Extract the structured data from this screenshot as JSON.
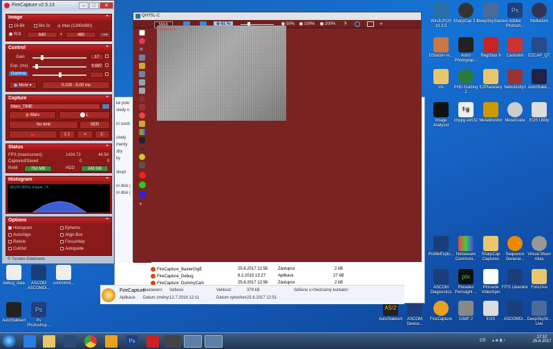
{
  "firecapture": {
    "title": "FireCapture v2.5.13",
    "image": {
      "header": "Image",
      "bit16": "16 Bit",
      "bin2x": "Bin 2x",
      "max": "Max (1280x960)",
      "roi": "ROI",
      "width": "640",
      "x": "x",
      "height": "480"
    },
    "control": {
      "header": "Control",
      "gain_label": "Gain",
      "gain_value": "17",
      "exp_label": "Exp. (ms)",
      "exp_value": "0.697",
      "gamma_label": "Gamma",
      "more": "More",
      "range": "0.100 - 5.00 ms"
    },
    "capture": {
      "header": "Capture",
      "profile": "Mars_TIME",
      "btn_mars": "Mars",
      "btn_l": "L",
      "nolimit": "No limit",
      "ser": "SER"
    },
    "status": {
      "header": "Status",
      "fps_label": "FPS (max/current)",
      "fps_max": "1434.72",
      "fps_cur": "44.54",
      "captured_label": "Captured/Saved",
      "captured": "0",
      "saved": "0",
      "ram_label": "RAM",
      "ram": "792 MB",
      "hdd_label": "HDD",
      "hdd": "243 GB"
    },
    "histogram": {
      "header": "Histogram",
      "stats": "64(220 (86%)  Unique: 74"
    },
    "options": {
      "header": "Options",
      "left": [
        "Histogram",
        "AutoAlign",
        "Reticle",
        "CutOut"
      ],
      "right": [
        "Ephems",
        "Align-Box",
        "FocusHelp",
        "Autoguide"
      ],
      "footer": "© Torsten Edelmann"
    }
  },
  "qhy": {
    "title": "QHY5L-C",
    "zoom": "61 %",
    "max": "MAX",
    "z50": "50%",
    "z100": "100%",
    "z200": "200%",
    "overlay": "Zoom 61%"
  },
  "explorer": {
    "nav": [
      "ké polo",
      "sledy n",
      "",
      "ní soub",
      "",
      "ulody",
      "menty",
      "zby",
      "ky",
      "",
      "skupi",
      "",
      "ní disk (",
      "ní disk ("
    ],
    "files": [
      {
        "name": "FireCapture_BaslerGigE",
        "date": "25.6.2017 12:56",
        "type": "Zástupce",
        "size": "2 kB"
      },
      {
        "name": "FireCapture_Debug",
        "date": "6.2.2015 13:27",
        "type": "Aplikace",
        "size": "27 kB"
      },
      {
        "name": "FireCapture_DummyCam",
        "date": "25.6.2017 12:56",
        "type": "Zástupce",
        "size": "2 kB"
      }
    ],
    "details": {
      "name": "FireCapture",
      "kind": "Aplikace",
      "settings_label": "Nastavení:",
      "settings": "Sdíleno",
      "size_label": "Velikost:",
      "size": "379 kB",
      "shared_label": "Sdíleno s:",
      "shared": "<Neznámý kontakt>",
      "modified_label": "Datum změny:",
      "modified": "12.7.2016 12:11",
      "created_label": "Datum vytvoření:",
      "created": "25.6.2017 12:51"
    }
  },
  "desktop_icons": [
    {
      "label": "WinJUPOS 10.3.5",
      "color": "#2a6fa6"
    },
    {
      "label": "SharpCap 2.9",
      "color": "#333"
    },
    {
      "label": "DeepSkyStacker",
      "color": "#4a6a9a"
    },
    {
      "label": "Adobe Photosh...",
      "color": "#1f3f7f"
    },
    {
      "label": "Stellarium",
      "color": "#335"
    },
    {
      "label": "DStation-m...",
      "color": "#c74"
    },
    {
      "label": "Astro Photograp...",
      "color": "#222"
    },
    {
      "label": "RegiStax 6",
      "color": "#c22"
    },
    {
      "label": "Castrator",
      "color": "#c33"
    },
    {
      "label": "EZCAP_QT",
      "color": "#2a4a8a"
    },
    {
      "label": "iris",
      "color": "#e9c66b"
    },
    {
      "label": "PHD Guiding 2",
      "color": "#2a7a3a"
    },
    {
      "label": "EZPlanetary",
      "color": "#e9c66b"
    },
    {
      "label": "Nebulosity3",
      "color": "#933"
    },
    {
      "label": "AutoStakk...",
      "color": "#224"
    },
    {
      "label": "Image Analyzer",
      "color": "#111"
    },
    {
      "label": "imppg-win32",
      "color": "#eee"
    },
    {
      "label": "MetaMonitor",
      "color": "#c90"
    },
    {
      "label": "MetaGuide",
      "color": "#ccc"
    },
    {
      "label": "EOS Utility",
      "color": "#ddd"
    },
    {
      "label": "ProfileExplo...",
      "color": "#1b3d7a"
    },
    {
      "label": "Noiseware Communi...",
      "color": "#e44"
    },
    {
      "label": "SharpCap Captures",
      "color": "#e9c66b"
    },
    {
      "label": "Sequence Generat...",
      "color": "#e80"
    },
    {
      "label": "Virtual Moon Atlas",
      "color": "#999"
    },
    {
      "label": "ASCOM Diagnostics",
      "color": "#1b3d7a"
    },
    {
      "label": "Pleiades Pixinsight ...",
      "color": "#111"
    },
    {
      "label": "Pinnacle VideoSpin",
      "color": "#fff"
    },
    {
      "label": "FITS Liberator",
      "color": "#1b3d7a"
    },
    {
      "label": "Foto2Avi",
      "color": "#e9c66b"
    },
    {
      "label": "AutoStakkert",
      "color": "#222"
    },
    {
      "label": "ASCOM Device...",
      "color": "#1b3d7a"
    },
    {
      "label": "FireCapture",
      "color": "#e9a020"
    },
    {
      "label": "GIMP 2",
      "color": "#888"
    },
    {
      "label": "EOS",
      "color": "#ddd"
    },
    {
      "label": "ASCOMDi...",
      "color": "#1b3d7a"
    },
    {
      "label": "DeepSkySt... Live",
      "color": "#4a6a9a"
    },
    {
      "label": "debug_data",
      "color": "#eee"
    },
    {
      "label": "ASCOM ASCOMDi...",
      "color": "#1b3d7a"
    },
    {
      "label": "controlmit...",
      "color": "#eee"
    },
    {
      "label": "AutoStakkert",
      "color": "#222"
    },
    {
      "label": "Ps Photoshop...",
      "color": "#1f3f7f"
    }
  ],
  "taskbar": {
    "lang": "CS",
    "time": "17:10",
    "date": "25.6.2017"
  }
}
